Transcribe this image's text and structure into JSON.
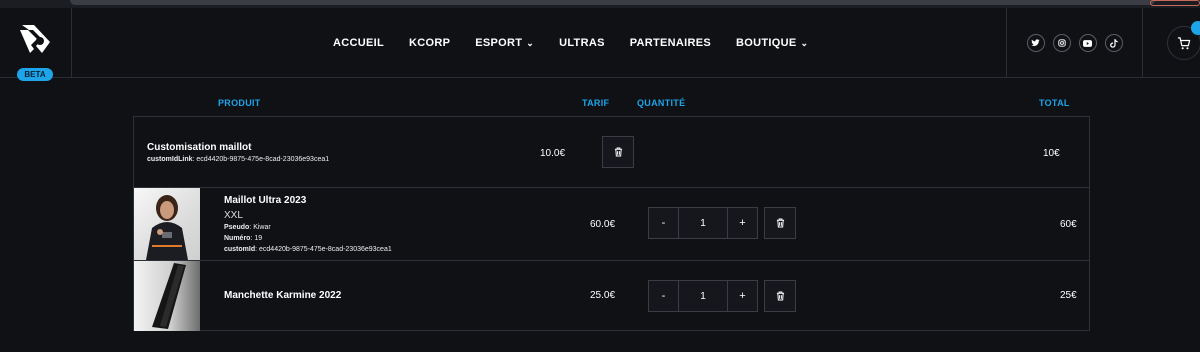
{
  "nav": {
    "beta": "BETA",
    "items": [
      {
        "label": "ACCUEIL",
        "dropdown": false
      },
      {
        "label": "KCORP",
        "dropdown": false
      },
      {
        "label": "ESPORT",
        "dropdown": true
      },
      {
        "label": "ULTRAS",
        "dropdown": false
      },
      {
        "label": "PARTENAIRES",
        "dropdown": false
      },
      {
        "label": "BOUTIQUE",
        "dropdown": true
      }
    ],
    "socials": [
      "twitter-icon",
      "instagram-icon",
      "youtube-icon",
      "tiktok-icon"
    ]
  },
  "cart": {
    "headers": {
      "product": "PRODUIT",
      "price": "TARIF",
      "quantity": "QUANTITÉ",
      "total": "TOTAL"
    },
    "rows": [
      {
        "name": "Customisation maillot",
        "link_label": "customIdLink",
        "link_value": "ecd4420b-9875-475e-8cad-23036e93cea1",
        "price": "10.0€",
        "total": "10€"
      },
      {
        "name": "Maillot Ultra 2023",
        "size": "XXL",
        "pseudo_label": "Pseudo",
        "pseudo_value": "Kiwar",
        "numero_label": "Numéro",
        "numero_value": "19",
        "customid_label": "customId",
        "customid_value": "ecd4420b-9875-475e-8cad-23036e93cea1",
        "price": "60.0€",
        "minus": "-",
        "quantity": "1",
        "plus": "+",
        "total": "60€"
      },
      {
        "name": "Manchette Karmine 2022",
        "price": "25.0€",
        "minus": "-",
        "quantity": "1",
        "plus": "+",
        "total": "25€"
      }
    ]
  },
  "colors": {
    "accent": "#1ea4e9",
    "background": "#0f1115",
    "border": "#2e3137"
  }
}
